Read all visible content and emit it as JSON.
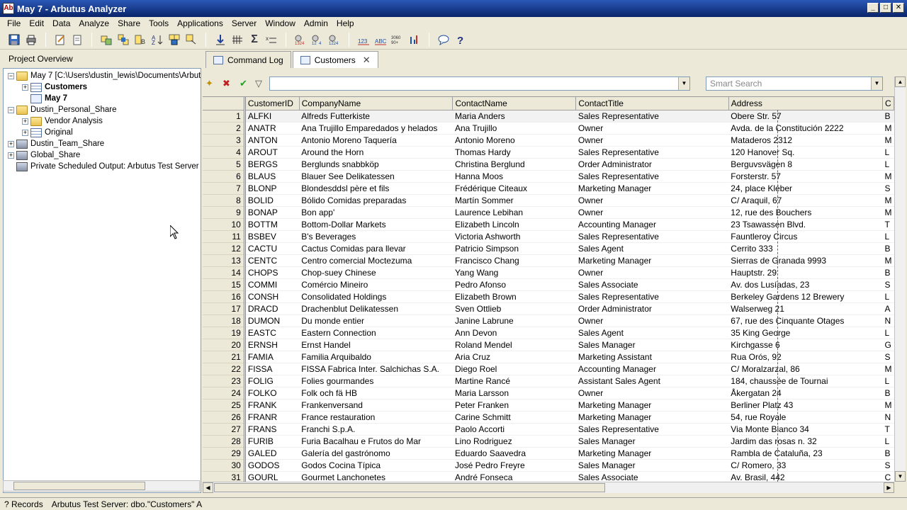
{
  "window": {
    "title": "May 7 - Arbutus Analyzer",
    "app_icon": "Ab",
    "minimize": "_",
    "maximize": "□",
    "close": "✕"
  },
  "menu": [
    "File",
    "Edit",
    "Data",
    "Analyze",
    "Share",
    "Tools",
    "Applications",
    "Server",
    "Window",
    "Admin",
    "Help"
  ],
  "left_panel": {
    "header": "Project Overview",
    "tree": [
      {
        "label": "May 7 [C:\\Users\\dustin_lewis\\Documents\\Arbutus",
        "icon": "folder-icon",
        "level": 0,
        "expander": "−",
        "bold": false
      },
      {
        "label": "Customers",
        "icon": "table-icon",
        "level": 1,
        "expander": "+",
        "bold": true
      },
      {
        "label": "May 7",
        "icon": "view-icon",
        "level": 1,
        "expander": "",
        "bold": true
      },
      {
        "label": "Dustin_Personal_Share",
        "icon": "folder-icon",
        "level": 0,
        "expander": "−",
        "bold": false
      },
      {
        "label": "Vendor Analysis",
        "icon": "folder-icon",
        "level": 1,
        "expander": "+",
        "bold": false
      },
      {
        "label": "Original",
        "icon": "table-icon",
        "level": 1,
        "expander": "+",
        "bold": false
      },
      {
        "label": "Dustin_Team_Share",
        "icon": "server-icon",
        "level": 0,
        "expander": "+",
        "bold": false
      },
      {
        "label": "Global_Share",
        "icon": "server-icon",
        "level": 0,
        "expander": "+",
        "bold": false
      },
      {
        "label": "Private Scheduled Output:  Arbutus Test Server",
        "icon": "server-icon",
        "level": 0,
        "expander": "",
        "bold": false
      }
    ]
  },
  "tabs": [
    {
      "label": "Command Log",
      "active": false
    },
    {
      "label": "Customers",
      "active": true,
      "close": "✕"
    }
  ],
  "filter": {
    "value": "",
    "smart_search_placeholder": "Smart Search"
  },
  "grid": {
    "columns": [
      "CustomerID",
      "CompanyName",
      "ContactName",
      "ContactTitle",
      "Address",
      "C"
    ],
    "rows": [
      [
        "1",
        "ALFKI",
        "Alfreds Futterkiste",
        "Maria Anders",
        "Sales Representative",
        "Obere Str. 57",
        "B"
      ],
      [
        "2",
        "ANATR",
        "Ana Trujillo Emparedados y helados",
        "Ana Trujillo",
        "Owner",
        "Avda. de la Constitución 2222",
        "M"
      ],
      [
        "3",
        "ANTON",
        "Antonio Moreno Taquería",
        "Antonio Moreno",
        "Owner",
        "Mataderos  2312",
        "M"
      ],
      [
        "4",
        "AROUT",
        "Around the Horn",
        "Thomas Hardy",
        "Sales Representative",
        "120 Hanover Sq.",
        "L"
      ],
      [
        "5",
        "BERGS",
        "Berglunds snabbköp",
        "Christina Berglund",
        "Order Administrator",
        "Berguvsvägen  8",
        "L"
      ],
      [
        "6",
        "BLAUS",
        "Blauer See Delikatessen",
        "Hanna Moos",
        "Sales Representative",
        "Forsterstr. 57",
        "M"
      ],
      [
        "7",
        "BLONP",
        "Blondesddsl père et fils",
        "Frédérique Citeaux",
        "Marketing Manager",
        "24, place Kléber",
        "S"
      ],
      [
        "8",
        "BOLID",
        "Bólido Comidas preparadas",
        "Martín Sommer",
        "Owner",
        "C/ Araquil, 67",
        "M"
      ],
      [
        "9",
        "BONAP",
        "Bon app'",
        "Laurence Lebihan",
        "Owner",
        "12, rue des Bouchers",
        "M"
      ],
      [
        "10",
        "BOTTM",
        "Bottom-Dollar Markets",
        "Elizabeth Lincoln",
        "Accounting Manager",
        "23 Tsawassen Blvd.",
        "T"
      ],
      [
        "11",
        "BSBEV",
        "B's Beverages",
        "Victoria Ashworth",
        "Sales Representative",
        "Fauntleroy Circus",
        "L"
      ],
      [
        "12",
        "CACTU",
        "Cactus Comidas para llevar",
        "Patricio Simpson",
        "Sales Agent",
        "Cerrito 333",
        "B"
      ],
      [
        "13",
        "CENTC",
        "Centro comercial Moctezuma",
        "Francisco Chang",
        "Marketing Manager",
        "Sierras de Granada 9993",
        "M"
      ],
      [
        "14",
        "CHOPS",
        "Chop-suey Chinese",
        "Yang Wang",
        "Owner",
        "Hauptstr. 29",
        "B"
      ],
      [
        "15",
        "COMMI",
        "Comércio Mineiro",
        "Pedro Afonso",
        "Sales Associate",
        "Av. dos Lusíadas, 23",
        "S"
      ],
      [
        "16",
        "CONSH",
        "Consolidated Holdings",
        "Elizabeth Brown",
        "Sales Representative",
        "Berkeley Gardens 12  Brewery",
        "L"
      ],
      [
        "17",
        "DRACD",
        "Drachenblut Delikatessen",
        "Sven Ottlieb",
        "Order Administrator",
        "Walserweg 21",
        "A"
      ],
      [
        "18",
        "DUMON",
        "Du monde entier",
        "Janine Labrune",
        "Owner",
        "67, rue des Cinquante Otages",
        "N"
      ],
      [
        "19",
        "EASTC",
        "Eastern Connection",
        "Ann Devon",
        "Sales Agent",
        "35 King George",
        "L"
      ],
      [
        "20",
        "ERNSH",
        "Ernst Handel",
        "Roland Mendel",
        "Sales Manager",
        "Kirchgasse 6",
        "G"
      ],
      [
        "21",
        "FAMIA",
        "Familia Arquibaldo",
        "Aria Cruz",
        "Marketing Assistant",
        "Rua Orós, 92",
        "S"
      ],
      [
        "22",
        "FISSA",
        "FISSA Fabrica Inter. Salchichas S.A.",
        "Diego Roel",
        "Accounting Manager",
        "C/ Moralzarzal, 86",
        "M"
      ],
      [
        "23",
        "FOLIG",
        "Folies gourmandes",
        "Martine Rancé",
        "Assistant Sales Agent",
        "184, chaussée de Tournai",
        "L"
      ],
      [
        "24",
        "FOLKO",
        "Folk och fä HB",
        "Maria Larsson",
        "Owner",
        "Åkergatan 24",
        "B"
      ],
      [
        "25",
        "FRANK",
        "Frankenversand",
        "Peter Franken",
        "Marketing Manager",
        "Berliner Platz 43",
        "M"
      ],
      [
        "26",
        "FRANR",
        "France restauration",
        "Carine Schmitt",
        "Marketing Manager",
        "54, rue Royale",
        "N"
      ],
      [
        "27",
        "FRANS",
        "Franchi S.p.A.",
        "Paolo Accorti",
        "Sales Representative",
        "Via Monte Bianco 34",
        "T"
      ],
      [
        "28",
        "FURIB",
        "Furia Bacalhau e Frutos do Mar",
        "Lino Rodriguez",
        "Sales Manager",
        "Jardim das rosas n. 32",
        "L"
      ],
      [
        "29",
        "GALED",
        "Galería del gastrónomo",
        "Eduardo Saavedra",
        "Marketing Manager",
        "Rambla de Cataluña, 23",
        "B"
      ],
      [
        "30",
        "GODOS",
        "Godos Cocina Típica",
        "José Pedro Freyre",
        "Sales Manager",
        "C/ Romero, 33",
        "S"
      ],
      [
        "31",
        "GOURL",
        "Gourmet Lanchonetes",
        "André Fonseca",
        "Sales Associate",
        "Av. Brasil, 442",
        "C"
      ]
    ]
  },
  "status": {
    "records": "? Records",
    "source": "Arbutus Test Server: dbo.\"Customers\" A"
  },
  "icons": {
    "save": "💾",
    "print": "🖶",
    "help": "?",
    "comment": "💬",
    "sigma": "Σ",
    "filter_add": "✦",
    "filter_remove": "✖",
    "filter_ok": "✔",
    "filter_funnel": "▽",
    "up_arrow": "▲",
    "down_arrow": "▼",
    "left_arrow": "◀",
    "right_arrow": "▶"
  },
  "colors": {
    "titlebar": "#0a246a",
    "panel": "#ece9d8",
    "border": "#7f9db9"
  }
}
